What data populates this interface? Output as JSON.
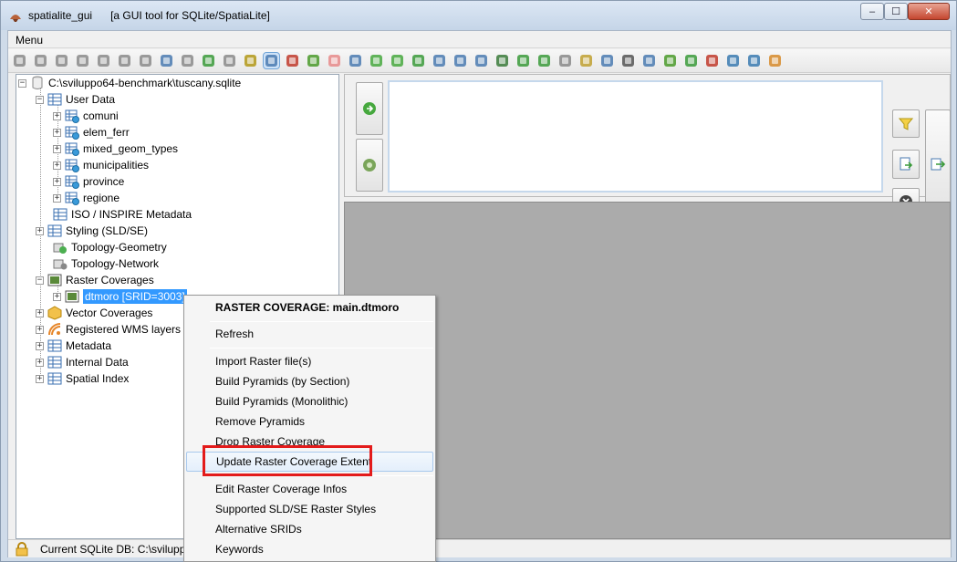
{
  "window": {
    "app_name": "spatialite_gui",
    "subtitle": "[a GUI tool for SQLite/SpatiaLite]",
    "minimize_label": "–",
    "maximize_label": "☐",
    "close_label": "✕"
  },
  "menubar": {
    "menu_label": "Menu"
  },
  "tree": {
    "root": "C:\\sviluppo64-benchmark\\tuscany.sqlite",
    "user_data": "User Data",
    "tables": [
      "comuni",
      "elem_ferr",
      "mixed_geom_types",
      "municipalities",
      "province",
      "regione"
    ],
    "iso_metadata": "ISO / INSPIRE Metadata",
    "styling": "Styling (SLD/SE)",
    "topology_geometry": "Topology-Geometry",
    "topology_network": "Topology-Network",
    "raster_coverages": "Raster Coverages",
    "raster_item": "dtmoro [SRID=3003]",
    "vector_coverages": "Vector Coverages",
    "wms_layers": "Registered WMS layers",
    "metadata": "Metadata",
    "internal_data": "Internal Data",
    "spatial_index": "Spatial Index"
  },
  "status": {
    "text": "Current SQLite DB: C:\\sviluppo64-benchmark\\tuscany.sqlite"
  },
  "context_menu": {
    "header": "RASTER COVERAGE: main.dtmoro",
    "refresh": "Refresh",
    "import_raster": "Import Raster file(s)",
    "build_pyramids_section": "Build Pyramids (by Section)",
    "build_pyramids_mono": "Build Pyramids (Monolithic)",
    "remove_pyramids": "Remove Pyramids",
    "drop_raster": "Drop Raster Coverage",
    "update_extent": "Update Raster Coverage Extent",
    "edit_infos": "Edit Raster Coverage Infos",
    "supported_styles": "Supported SLD/SE Raster Styles",
    "alternative_srids": "Alternative SRIDs",
    "keywords": "Keywords"
  },
  "colors": {
    "highlight_box": "#e31b1b",
    "selection": "#3399ff",
    "results_bg": "#ababab"
  }
}
